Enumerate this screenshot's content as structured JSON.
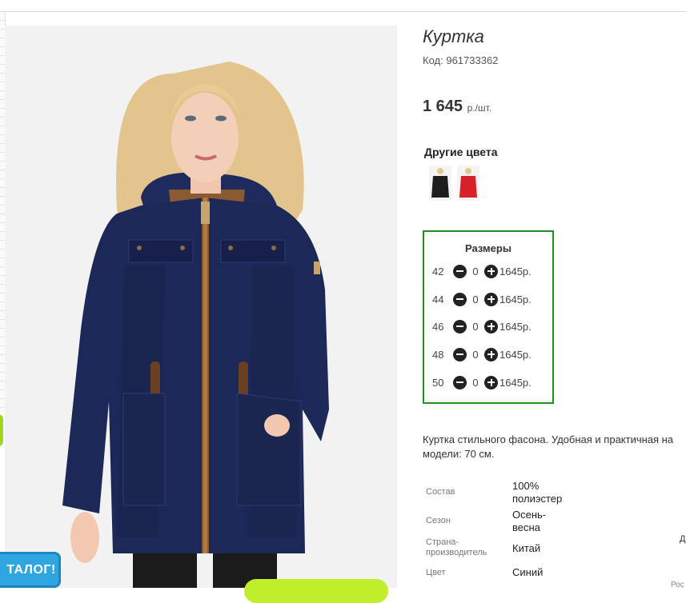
{
  "product": {
    "title": "Куртка",
    "code_label": "Код:",
    "code_value": "961733362",
    "price_value": "1 645",
    "price_unit": "р./шт."
  },
  "other_colors": {
    "title": "Другие цвета",
    "swatches": [
      {
        "name": "black",
        "color": "#1e1e1e"
      },
      {
        "name": "red",
        "color": "#d6202a"
      }
    ]
  },
  "sizes": {
    "title": "Размеры",
    "rows": [
      {
        "size": "42",
        "qty": "0",
        "price": "1645р."
      },
      {
        "size": "44",
        "qty": "0",
        "price": "1645р."
      },
      {
        "size": "46",
        "qty": "0",
        "price": "1645р."
      },
      {
        "size": "48",
        "qty": "0",
        "price": "1645р."
      },
      {
        "size": "50",
        "qty": "0",
        "price": "1645р."
      }
    ],
    "border_color": "#1f8f1f"
  },
  "description": "Куртка стильного фасона. Удобная и практичная на модели: 70 см.",
  "specs": [
    {
      "label": "Состав",
      "value": "100% полиэстер"
    },
    {
      "label": "Сезон",
      "value": "Осень-весна"
    },
    {
      "label": "Страна-производитель",
      "value": "Китай"
    },
    {
      "label": "Цвет",
      "value": "Синий"
    }
  ],
  "catalog_button": {
    "label": "ТАЛОГ!"
  },
  "edge_text": {
    "d": "Д",
    "ros": "Рос"
  },
  "colors": {
    "jacket": "#1c2857",
    "accent_green": "#bfee2a",
    "catalog_blue": "#2fa6e0"
  }
}
